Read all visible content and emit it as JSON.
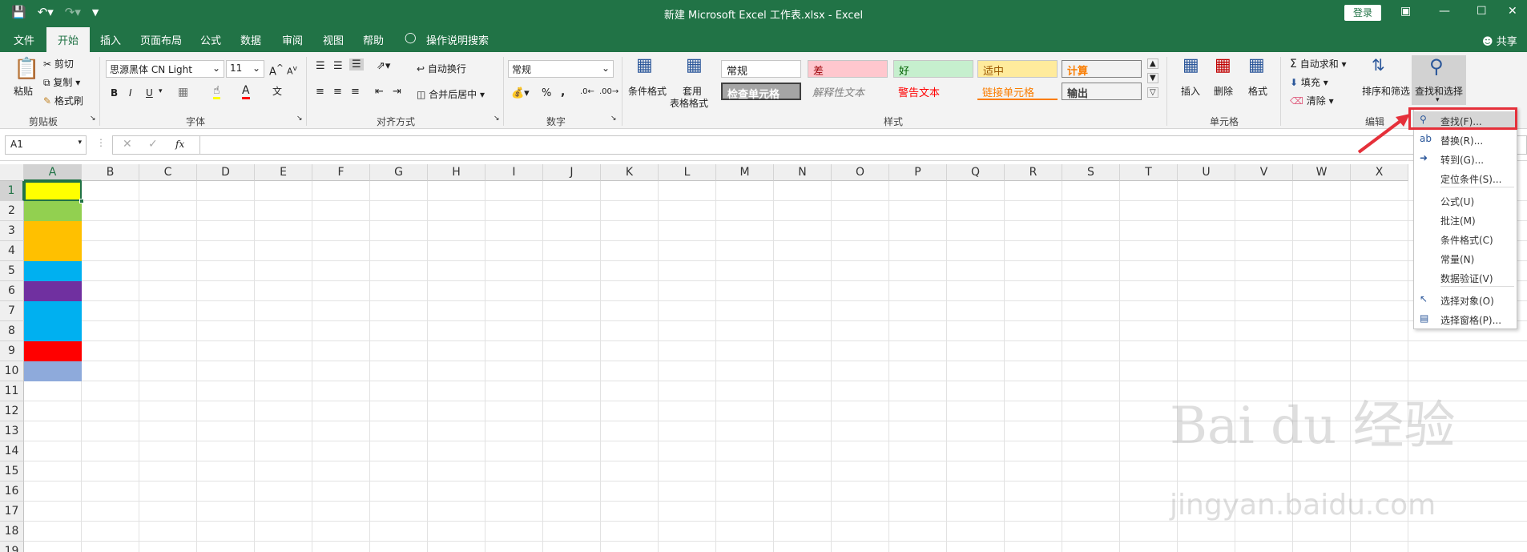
{
  "window": {
    "title": "新建 Microsoft Excel 工作表.xlsx  -  Excel",
    "login": "登录",
    "share": "共享"
  },
  "tabs": [
    "文件",
    "开始",
    "插入",
    "页面布局",
    "公式",
    "数据",
    "审阅",
    "视图",
    "帮助",
    "操作说明搜索"
  ],
  "ribbon": {
    "clipboard": {
      "paste": "粘贴",
      "cut": "剪切",
      "copy": "复制",
      "format_painter": "格式刷",
      "label": "剪贴板"
    },
    "font": {
      "name": "思源黑体 CN Light",
      "size": "11",
      "label": "字体",
      "bold": "B",
      "italic": "I",
      "underline": "U"
    },
    "alignment": {
      "wrap": "自动换行",
      "merge": "合并后居中",
      "label": "对齐方式"
    },
    "number": {
      "format": "常规",
      "label": "数字",
      "percent": "%",
      "comma": ","
    },
    "styles": {
      "conditional": "条件格式",
      "table_format_1": "套用",
      "table_format_2": "表格格式",
      "label": "样式",
      "cells": [
        {
          "text": "常规",
          "bg": "#ffffff",
          "color": "#222222"
        },
        {
          "text": "差",
          "bg": "#ffc7ce",
          "color": "#9c0006"
        },
        {
          "text": "好",
          "bg": "#c6efce",
          "color": "#006100"
        },
        {
          "text": "适中",
          "bg": "#ffeb9c",
          "color": "#9c5700"
        },
        {
          "text": "计算",
          "bg": "#f2f2f2",
          "color": "#fa7d00"
        },
        {
          "text": "检查单元格",
          "bg": "#a5a5a5",
          "color": "#ffffff"
        },
        {
          "text": "解释性文本",
          "bg": "#f3f3f3",
          "color": "#7f7f7f"
        },
        {
          "text": "警告文本",
          "bg": "#f3f3f3",
          "color": "#ff0000"
        },
        {
          "text": "链接单元格",
          "bg": "#f3f3f3",
          "color": "#fa7d00"
        },
        {
          "text": "输出",
          "bg": "#f2f2f2",
          "color": "#3f3f3f"
        }
      ]
    },
    "cells_group": {
      "insert": "插入",
      "delete": "删除",
      "format": "格式",
      "label": "单元格"
    },
    "editing": {
      "autosum": "自动求和",
      "fill": "填充",
      "clear": "清除",
      "sort_filter": "排序和筛选",
      "find_select": "查找和选择",
      "label": "编辑"
    }
  },
  "formula_bar": {
    "name_box": "A1",
    "fx": "fx",
    "value": ""
  },
  "columns": [
    "A",
    "B",
    "C",
    "D",
    "E",
    "F",
    "G",
    "H",
    "I",
    "J",
    "K",
    "L",
    "M",
    "N",
    "O",
    "P",
    "Q",
    "R",
    "S",
    "T",
    "U",
    "V",
    "W",
    "X"
  ],
  "rows": [
    "1",
    "2",
    "3",
    "4",
    "5",
    "6",
    "7",
    "8",
    "9",
    "10",
    "11",
    "12",
    "13",
    "14",
    "15",
    "16",
    "17",
    "18",
    "19"
  ],
  "column_a_fills": [
    "#ffff00",
    "#92d050",
    "#ffc000",
    "#ffc000",
    "#00b0f0",
    "#7030a0",
    "#00b0f0",
    "#00b0f0",
    "#ff0000",
    "#8eaadb"
  ],
  "menu": {
    "items": [
      {
        "label": "查找(F)...",
        "icon": "search-icon"
      },
      {
        "label": "替换(R)...",
        "icon": "replace-icon"
      },
      {
        "label": "转到(G)...",
        "icon": "arrow-right-icon"
      },
      {
        "label": "定位条件(S)...",
        "icon": ""
      },
      {
        "label": "公式(U)",
        "icon": ""
      },
      {
        "label": "批注(M)",
        "icon": ""
      },
      {
        "label": "条件格式(C)",
        "icon": ""
      },
      {
        "label": "常量(N)",
        "icon": ""
      },
      {
        "label": "数据验证(V)",
        "icon": ""
      },
      {
        "label": "选择对象(O)",
        "icon": "cursor-icon"
      },
      {
        "label": "选择窗格(P)...",
        "icon": "selection-pane-icon"
      }
    ]
  },
  "watermark": {
    "line1": "Bai du 经验",
    "line2": "jingyan.baidu.com"
  }
}
